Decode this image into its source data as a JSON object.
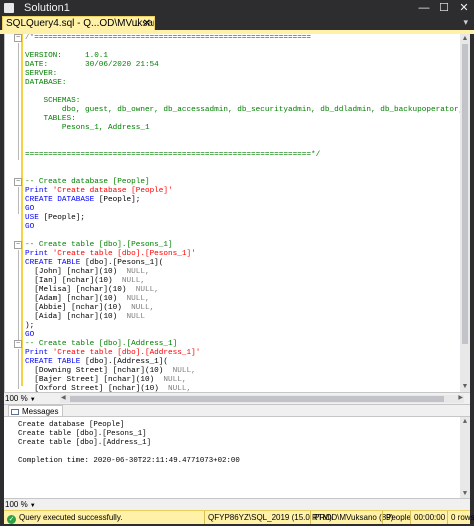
{
  "window": {
    "title": "Solution1",
    "controls": {
      "minimize": "—",
      "maximize": "☐",
      "close": "✕"
    }
  },
  "tab": {
    "label": "SQLQuery4.sql - Q...OD\\MVuksano (89))*",
    "pin": "⊥",
    "close": "✕"
  },
  "editor": {
    "lines": [
      [
        {
          "c": "c-gy",
          "t": "/*"
        },
        {
          "c": "c-cm",
          "t": "============================================================"
        }
      ],
      [],
      [
        {
          "c": "c-cm",
          "t": "VERSION:     1.0.1"
        }
      ],
      [
        {
          "c": "c-cm",
          "t": "DATE:        30/06/2020 21:54"
        }
      ],
      [
        {
          "c": "c-cm",
          "t": "SERVER:"
        }
      ],
      [
        {
          "c": "c-cm",
          "t": "DATABASE:"
        }
      ],
      [],
      [
        {
          "c": "c-cm",
          "t": "    SCHEMAS:"
        }
      ],
      [
        {
          "c": "c-cm",
          "t": "        dbo, guest, db_owner, db_accessadmin, db_securityadmin, db_ddladmin, db_backupoperator, db_datareader,"
        }
      ],
      [
        {
          "c": "c-cm",
          "t": "    TABLES:"
        }
      ],
      [
        {
          "c": "c-cm",
          "t": "        Pesons_1, Address_1"
        }
      ],
      [],
      [],
      [
        {
          "c": "c-cm",
          "t": "==============================================================*/"
        }
      ],
      [],
      [],
      [
        {
          "c": "c-cm",
          "t": "-- Create database [People]"
        }
      ],
      [
        {
          "c": "c-kw",
          "t": "Print "
        },
        {
          "c": "c-st",
          "t": "'Create database [People]'"
        }
      ],
      [
        {
          "c": "c-kw",
          "t": "CREATE DATABASE "
        },
        {
          "c": "c-tx",
          "t": "[People];"
        }
      ],
      [
        {
          "c": "c-kw",
          "t": "GO"
        }
      ],
      [
        {
          "c": "c-kw",
          "t": "USE "
        },
        {
          "c": "c-tx",
          "t": "[People];"
        }
      ],
      [
        {
          "c": "c-kw",
          "t": "GO"
        }
      ],
      [],
      [
        {
          "c": "c-cm",
          "t": "-- Create table [dbo].[Pesons_1]"
        }
      ],
      [
        {
          "c": "c-kw",
          "t": "Print "
        },
        {
          "c": "c-st",
          "t": "'Create table [dbo].[Pesons_1]'"
        }
      ],
      [
        {
          "c": "c-kw",
          "t": "CREATE TABLE "
        },
        {
          "c": "c-tx",
          "t": "[dbo].[Pesons_1]("
        }
      ],
      [
        {
          "c": "c-tx",
          "t": "  [John] [nchar]("
        },
        {
          "c": "c-tx",
          "t": "10"
        },
        {
          "c": "c-tx",
          "t": ")  "
        },
        {
          "c": "c-gy",
          "t": "NULL,"
        }
      ],
      [
        {
          "c": "c-tx",
          "t": "  [Ian] [nchar]("
        },
        {
          "c": "c-tx",
          "t": "10"
        },
        {
          "c": "c-tx",
          "t": ")  "
        },
        {
          "c": "c-gy",
          "t": "NULL,"
        }
      ],
      [
        {
          "c": "c-tx",
          "t": "  [Melisa] [nchar]("
        },
        {
          "c": "c-tx",
          "t": "10"
        },
        {
          "c": "c-tx",
          "t": ")  "
        },
        {
          "c": "c-gy",
          "t": "NULL,"
        }
      ],
      [
        {
          "c": "c-tx",
          "t": "  [Adam] [nchar]("
        },
        {
          "c": "c-tx",
          "t": "10"
        },
        {
          "c": "c-tx",
          "t": ")  "
        },
        {
          "c": "c-gy",
          "t": "NULL,"
        }
      ],
      [
        {
          "c": "c-tx",
          "t": "  [Abbie] [nchar]("
        },
        {
          "c": "c-tx",
          "t": "10"
        },
        {
          "c": "c-tx",
          "t": ")  "
        },
        {
          "c": "c-gy",
          "t": "NULL,"
        }
      ],
      [
        {
          "c": "c-tx",
          "t": "  [Aida] [nchar]("
        },
        {
          "c": "c-tx",
          "t": "10"
        },
        {
          "c": "c-tx",
          "t": ")  "
        },
        {
          "c": "c-gy",
          "t": "NULL"
        }
      ],
      [
        {
          "c": "c-tx",
          "t": ");"
        }
      ],
      [
        {
          "c": "c-kw",
          "t": "GO"
        }
      ],
      [
        {
          "c": "c-cm",
          "t": "-- Create table [dbo].[Address_1]"
        }
      ],
      [
        {
          "c": "c-kw",
          "t": "Print "
        },
        {
          "c": "c-st",
          "t": "'Create table [dbo].[Address_1]'"
        }
      ],
      [
        {
          "c": "c-kw",
          "t": "CREATE TABLE "
        },
        {
          "c": "c-tx",
          "t": "[dbo].[Address_1]("
        }
      ],
      [
        {
          "c": "c-tx",
          "t": "  [Downing Street] [nchar]("
        },
        {
          "c": "c-tx",
          "t": "10"
        },
        {
          "c": "c-tx",
          "t": ")  "
        },
        {
          "c": "c-gy",
          "t": "NULL,"
        }
      ],
      [
        {
          "c": "c-tx",
          "t": "  [Bajer Street] [nchar]("
        },
        {
          "c": "c-tx",
          "t": "10"
        },
        {
          "c": "c-tx",
          "t": ")  "
        },
        {
          "c": "c-gy",
          "t": "NULL,"
        }
      ],
      [
        {
          "c": "c-tx",
          "t": "  [Oxford Street] [nchar]("
        },
        {
          "c": "c-tx",
          "t": "10"
        },
        {
          "c": "c-tx",
          "t": ")  "
        },
        {
          "c": "c-gy",
          "t": "NULL,"
        }
      ]
    ],
    "zoom": "100 %"
  },
  "results": {
    "tab_label": "Messages",
    "lines": [
      "Create database [People]",
      "Create table [dbo].[Pesons_1]",
      "Create table [dbo].[Address_1]",
      "",
      "Completion time: 2020-06-30T22:11:49.4771073+02:00"
    ],
    "zoom": "100 %"
  },
  "status": {
    "message": "Query executed successfully.",
    "server": "QFYP86YZ\\SQL_2019 (15.0 RTM)",
    "user": "PROD\\MVuksano (89)",
    "database": "People",
    "elapsed": "00:00:00",
    "rows": "0 rows"
  },
  "colors": {
    "accent": "#fff1a8",
    "keyword": "#0000ff",
    "comment": "#008000",
    "string": "#ff0000",
    "chrome": "#2d2d30"
  }
}
